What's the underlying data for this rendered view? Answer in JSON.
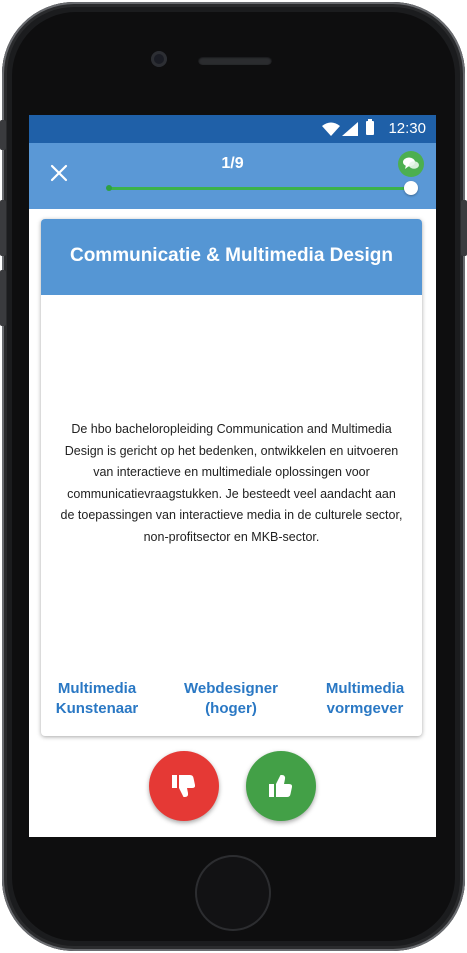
{
  "status_bar": {
    "time": "12:30"
  },
  "app_bar": {
    "progress_label": "1/9",
    "progress_fraction": 1.0
  },
  "card": {
    "title": "Communicatie & Multimedia Design",
    "description": "De hbo bacheloropleiding Communication and Multimedia Design is gericht op het bedenken, ontwikkelen en uitvoeren van interactieve en multimediale oplossingen voor communicatievraagstukken. Je besteedt veel aandacht aan de toepassingen van interactieve media in de culturele sector, non-profitsector en MKB-sector.",
    "careers": [
      {
        "line1": "Multimedia",
        "line2": "Kunstenaar"
      },
      {
        "line1": "Webdesigner",
        "line2": "(hoger)"
      },
      {
        "line1": "Multimedia",
        "line2": "vormgever"
      }
    ]
  },
  "actions": {
    "dislike": "thumbs-down-icon",
    "like": "thumbs-up-icon"
  },
  "colors": {
    "status_bar": "#1f60a8",
    "app_bar": "#5a98d6",
    "card_header": "#5596d4",
    "career_link": "#2a78c4",
    "dislike": "#e53935",
    "like": "#43a047"
  }
}
